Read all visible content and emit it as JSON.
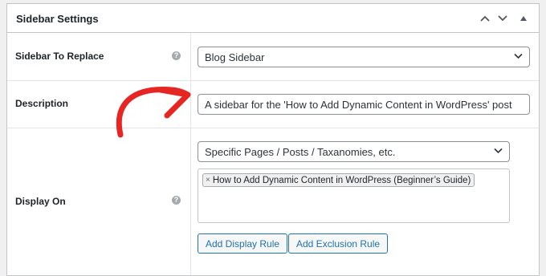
{
  "panel": {
    "title": "Sidebar Settings"
  },
  "rows": {
    "replace": {
      "label": "Sidebar To Replace",
      "help": "?",
      "selected": "Blog Sidebar"
    },
    "description": {
      "label": "Description",
      "value": "A sidebar for the 'How to Add Dynamic Content in WordPress' post"
    },
    "display_on": {
      "label": "Display On",
      "help": "?",
      "selected": "Specific Pages / Posts / Taxanomies, etc.",
      "tag_remove": "×",
      "tag": "How to Add Dynamic Content in WordPress (Beginner’s Guide)",
      "add_display_rule": "Add Display Rule",
      "add_exclusion_rule": "Add Exclusion Rule"
    }
  },
  "colors": {
    "accent": "#2271b1",
    "annotation_arrow": "#e62623",
    "border": "#c3c4c7"
  },
  "icons": [
    "chevron-up-icon",
    "chevron-down-icon",
    "triangle-up-icon",
    "help-icon",
    "select-chevron-icon",
    "red-arrow-annotation"
  ]
}
